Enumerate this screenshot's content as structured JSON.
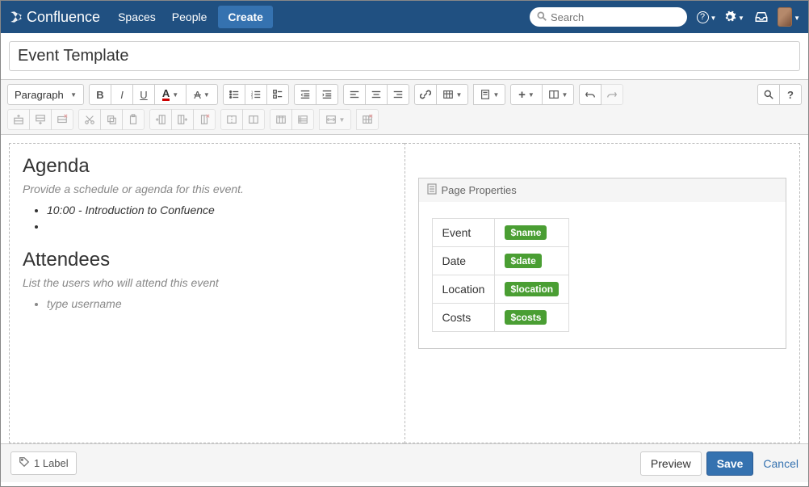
{
  "nav": {
    "product": "Confluence",
    "spaces": "Spaces",
    "people": "People",
    "create": "Create",
    "search_placeholder": "Search"
  },
  "page_title": "Event Template",
  "toolbar": {
    "format_select": "Paragraph"
  },
  "content": {
    "left": {
      "agenda_heading": "Agenda",
      "agenda_instr": "Provide a schedule or agenda for this event.",
      "agenda_items": [
        "10:00 - Introduction to Confuence",
        ""
      ],
      "attendees_heading": "Attendees",
      "attendees_instr": "List the users who will attend this event",
      "attendees_items": [
        "type username"
      ]
    },
    "right": {
      "panel_title": "Page Properties",
      "properties": [
        {
          "label": "Event",
          "variable": "$name"
        },
        {
          "label": "Date",
          "variable": "$date"
        },
        {
          "label": "Location",
          "variable": "$location"
        },
        {
          "label": "Costs",
          "variable": "$costs"
        }
      ]
    }
  },
  "footer": {
    "label_count": "1 Label",
    "preview": "Preview",
    "save": "Save",
    "cancel": "Cancel"
  }
}
